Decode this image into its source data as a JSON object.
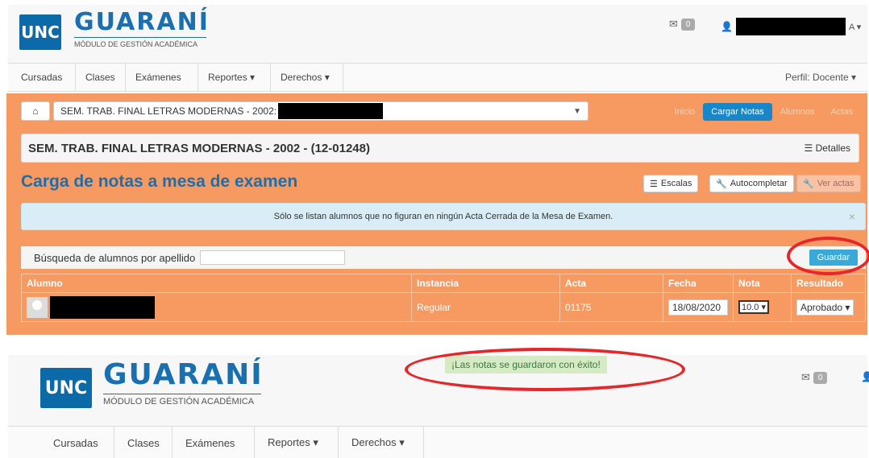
{
  "logo": {
    "box_text": "UNC",
    "word": "GUARANÍ",
    "subtitle": "MÓDULO DE GESTIÓN ACADÉMICA"
  },
  "header": {
    "mail_count": "0",
    "user_suffix": "A ▾"
  },
  "nav": {
    "items": [
      "Cursadas",
      "Clases",
      "Exámenes",
      "Reportes ▾",
      "Derechos ▾"
    ],
    "perfil": "Perfil: Docente ▾"
  },
  "toolbar": {
    "home_icon": "⌂",
    "select_value": "SEM. TRAB. FINAL LETRAS MODERNAS - 2002:",
    "tabs": [
      "Inicio",
      "Cargar Notas",
      "Alumnos",
      "Actas"
    ],
    "active_tab": "Cargar Notas"
  },
  "course": {
    "title": "SEM. TRAB. FINAL LETRAS MODERNAS - 2002 - (12-01248)",
    "details_label": "☰ Detalles"
  },
  "main": {
    "title": "Carga de notas a mesa de examen",
    "buttons": {
      "escalas": "Escalas",
      "autocompletar": "Autocompletar",
      "ver_actas": "Ver actas"
    }
  },
  "alert": {
    "text": "Sólo se listan alumnos que no figuran en ningún Acta Cerrada de la Mesa de Examen.",
    "close": "×"
  },
  "search": {
    "label": "Búsqueda de alumnos por apellido",
    "value": "",
    "save_label": "Guardar"
  },
  "table": {
    "headers": [
      "Alumno",
      "Instancia",
      "Acta",
      "Fecha",
      "Nota",
      "Resultado"
    ],
    "rows": [
      {
        "instancia": "Regular",
        "acta": "01175",
        "fecha": "18/08/2020",
        "nota": "10.0 ▾",
        "resultado": "Aprobado ▾"
      }
    ]
  },
  "success": {
    "text": "¡Las notas se guardaron con éxito!"
  },
  "colors": {
    "orange": "#f79a62",
    "brand_blue": "#1a6fb0",
    "accent_blue": "#1787c9",
    "annotation_red": "#e8262a"
  },
  "icons": {
    "mail": "envelope-icon",
    "user": "user-icon",
    "home": "home-icon",
    "list": "list-icon",
    "wrench": "wrench-icon"
  }
}
